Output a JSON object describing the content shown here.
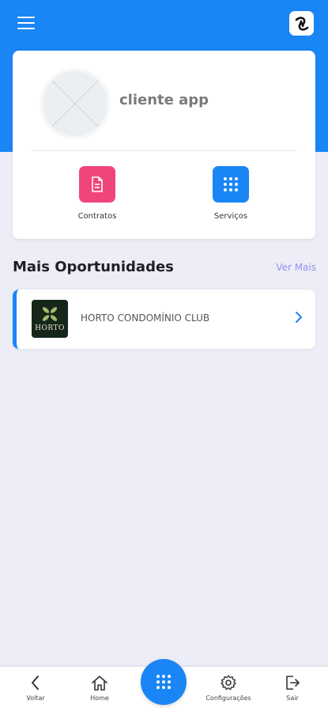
{
  "header": {
    "menu_icon": "hamburger-menu-icon",
    "logo_icon": "app-logo-icon",
    "background_color": "#1a85f5"
  },
  "profile": {
    "name": "cliente app",
    "avatar_icon": "placeholder-avatar-icon",
    "actions": [
      {
        "label": "Contratos",
        "icon": "document-icon",
        "color": "#f0457a"
      },
      {
        "label": "Serviços",
        "icon": "grid-icon",
        "color": "#1a85f5"
      }
    ]
  },
  "opportunities": {
    "title": "Mais Oportunidades",
    "see_more": "Ver Mais",
    "items": [
      {
        "name": "HORTO CONDOMÍNIO CLUB",
        "logo_text": "HORTO",
        "icon": "chevron-right-icon"
      }
    ]
  },
  "bottom_nav": {
    "items": [
      {
        "label": "Voltar",
        "icon": "chevron-left-icon"
      },
      {
        "label": "Home",
        "icon": "home-icon"
      },
      {
        "label": "Configurações",
        "icon": "gear-icon"
      },
      {
        "label": "Sair",
        "icon": "logout-icon"
      }
    ],
    "center_icon": "grid-icon"
  }
}
